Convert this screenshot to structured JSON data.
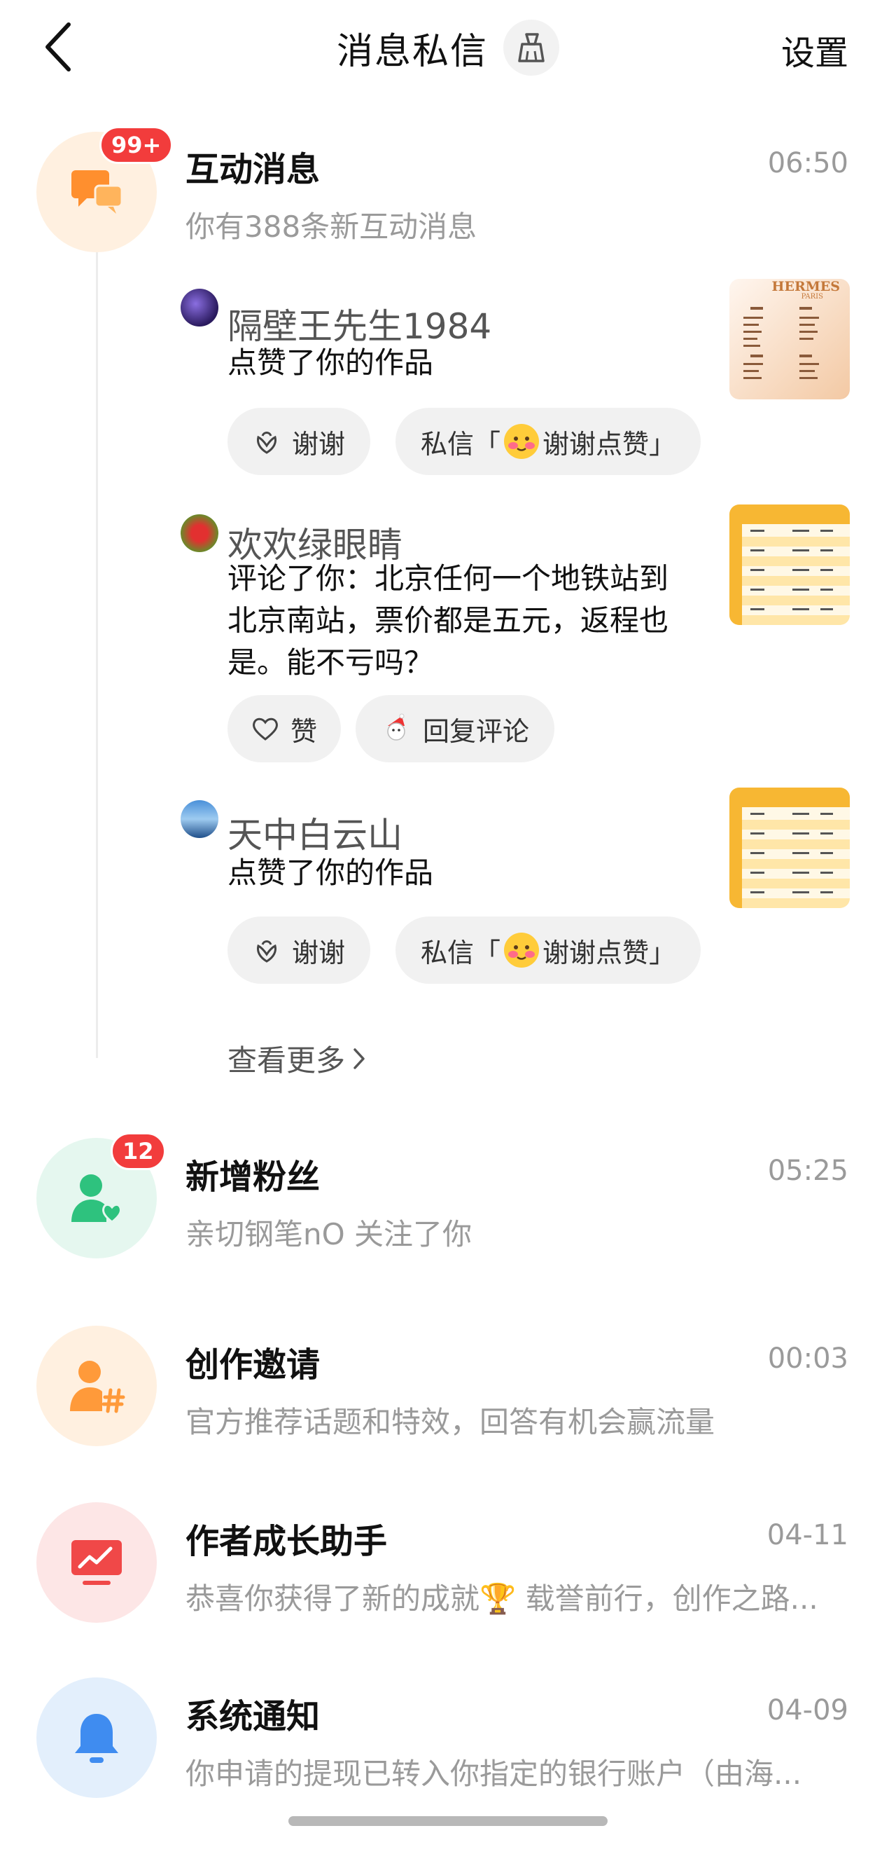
{
  "header": {
    "title": "消息私信",
    "settings": "设置"
  },
  "interactive": {
    "title": "互动消息",
    "time": "06:50",
    "subtitle": "你有388条新互动消息",
    "badge": "99+",
    "items": [
      {
        "user": "隔壁王先生1984",
        "text": "点赞了你的作品",
        "chip1": "谢谢",
        "chip2": "私信「",
        "chip2_tail": "谢谢点赞」"
      },
      {
        "user": "欢欢绿眼睛",
        "text": "评论了你：北京任何一个地铁站到北京南站，票价都是五元，返程也是。能不亏吗？",
        "chip1": "赞",
        "chip2": "回复评论"
      },
      {
        "user": "天中白云山",
        "text": "点赞了你的作品",
        "chip1": "谢谢",
        "chip2": "私信「",
        "chip2_tail": "谢谢点赞」"
      }
    ],
    "more": "查看更多"
  },
  "rows": [
    {
      "title": "新增粉丝",
      "time": "05:25",
      "subtitle": "亲切钢笔nO 关注了你",
      "badge": "12"
    },
    {
      "title": "创作邀请",
      "time": "00:03",
      "subtitle": "官方推荐话题和特效，回答有机会赢流量"
    },
    {
      "title": "作者成长助手",
      "time": "04-11",
      "subtitle": "恭喜你获得了新的成就🏆 载誉前行，创作之路..."
    },
    {
      "title": "系统通知",
      "time": "04-09",
      "subtitle": "你申请的提现已转入你指定的银行账户（由海..."
    }
  ],
  "thumb1": {
    "brand": "HERMES",
    "brand_sub": "PARIS"
  },
  "colors": {
    "interactive_bg": "#fff0e0",
    "interactive_icon": "#ff8f2e",
    "fans_bg": "#e5f7ef",
    "fans_icon": "#2ec27e",
    "invite_bg": "#fff0e0",
    "invite_icon": "#ff8f2e",
    "growth_bg": "#fde6e6",
    "growth_icon": "#f04848",
    "system_bg": "#e3effc",
    "system_icon": "#3f8cf0"
  }
}
